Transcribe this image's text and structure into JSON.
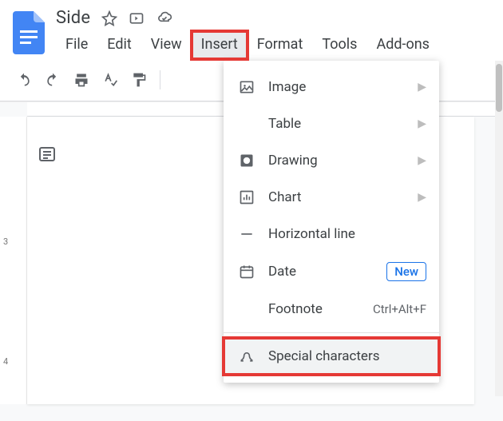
{
  "doc": {
    "title": "Side"
  },
  "menubar": {
    "file": "File",
    "edit": "Edit",
    "view": "View",
    "insert": "Insert",
    "format": "Format",
    "tools": "Tools",
    "addons": "Add-ons"
  },
  "ruler": {
    "tick3": "3",
    "tick4": "4"
  },
  "insert_menu": {
    "image": "Image",
    "table": "Table",
    "drawing": "Drawing",
    "chart": "Chart",
    "hline": "Horizontal line",
    "date": "Date",
    "date_badge": "New",
    "footnote": "Footnote",
    "footnote_shortcut": "Ctrl+Alt+F",
    "special": "Special characters"
  }
}
